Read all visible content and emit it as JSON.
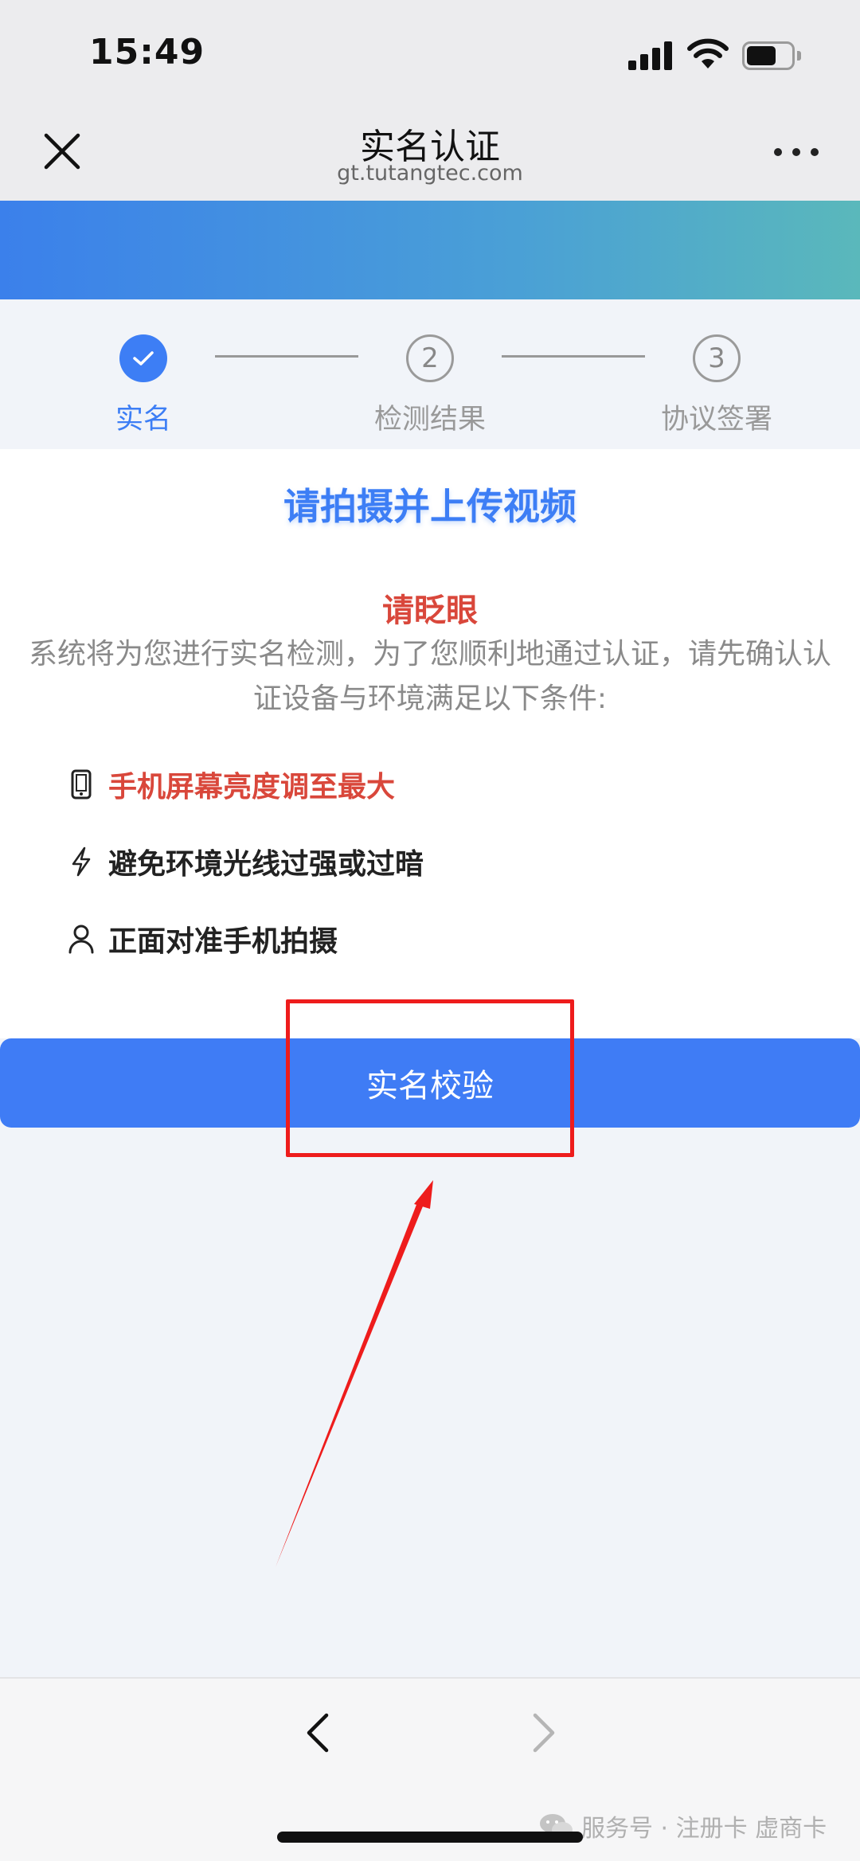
{
  "status": {
    "time": "15:49"
  },
  "header": {
    "title": "实名认证",
    "url": "gt.tutangtec.com"
  },
  "steps": [
    {
      "label": "实名",
      "number": "",
      "state": "done"
    },
    {
      "label": "检测结果",
      "number": "2",
      "state": "todo"
    },
    {
      "label": "协议签署",
      "number": "3",
      "state": "todo"
    }
  ],
  "content": {
    "heading": "请拍摄并上传视频",
    "warning": "请眨眼",
    "description": "系统将为您进行实名检测，为了您顺利地通过认证，请先确认认证设备与环境满足以下条件:",
    "conditions": [
      {
        "icon": "phone-icon",
        "text": "手机屏幕亮度调至最大",
        "highlight": true
      },
      {
        "icon": "lightning-icon",
        "text": "避免环境光线过强或过暗",
        "highlight": false
      },
      {
        "icon": "person-icon",
        "text": "正面对准手机拍摄",
        "highlight": false
      }
    ]
  },
  "button": {
    "label": "实名校验"
  },
  "watermark": {
    "text": "服务号 · 注册卡 虚商卡"
  },
  "colors": {
    "primary": "#3f7cf5",
    "warning": "#d9473b",
    "annotation": "#ee1c1c"
  }
}
